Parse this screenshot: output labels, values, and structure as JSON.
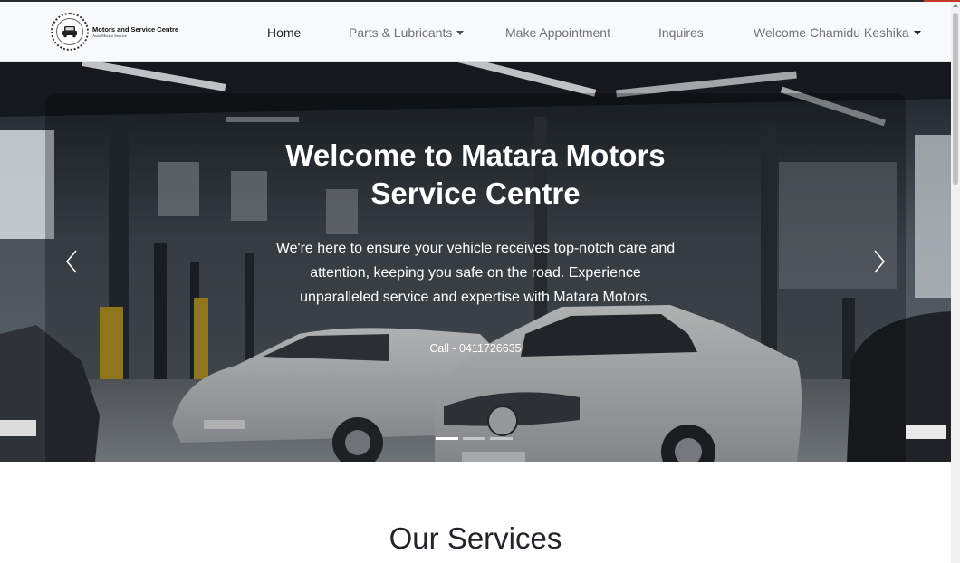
{
  "brand": {
    "title": "Motors and Service Centre",
    "subtitle": "Auto Motive Service"
  },
  "nav": {
    "home": "Home",
    "parts": "Parts & Lubricants",
    "appointment": "Make Appointment",
    "inquires": "Inquires",
    "user": "Welcome Chamidu Keshika"
  },
  "hero": {
    "title_line1": "Welcome to Matara Motors",
    "title_line2": "Service Centre",
    "text": "We're here to ensure your vehicle receives top-notch care and attention, keeping you safe on the road. Experience unparalleled service and expertise with Matara Motors.",
    "call": "Call - 0411726635",
    "slide_count": 3,
    "active_slide": 1
  },
  "services": {
    "title": "Our Services"
  },
  "colors": {
    "navbar_bg": "#f8f9fa",
    "nav_text": "#6c757d",
    "nav_active": "#212529",
    "hero_text": "#ffffff"
  }
}
